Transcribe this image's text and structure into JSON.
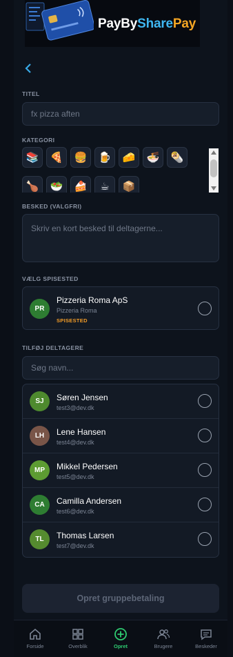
{
  "brand": {
    "part1": "PayBy",
    "part2": "Share",
    "part3": "Pay"
  },
  "form": {
    "title_label": "TITEL",
    "title_placeholder": "fx pizza aften",
    "category_label": "KATEGORI",
    "categories": [
      "📚",
      "🍕",
      "🍔",
      "🍺",
      "🧀",
      "🍜",
      "🌯",
      "🍗",
      "🥗",
      "🍰",
      "☕",
      "📦"
    ],
    "message_label": "BESKED (VALGFRI)",
    "message_placeholder": "Skriv en kort besked til deltagerne...",
    "venue_label": "VÆLG SPISESTED",
    "venue": {
      "initials": "PR",
      "name": "Pizzeria Roma ApS",
      "sub": "Pizzeria Roma",
      "tag": "SPISESTED",
      "color": "#2e7d32"
    },
    "participants_label": "TILFØJ DELTAGERE",
    "search_placeholder": "Søg navn...",
    "participants": [
      {
        "initials": "SJ",
        "name": "Søren Jensen",
        "email": "test3@dev.dk",
        "color": "#4e8a2e"
      },
      {
        "initials": "LH",
        "name": "Lene Hansen",
        "email": "test4@dev.dk",
        "color": "#795548"
      },
      {
        "initials": "MP",
        "name": "Mikkel Pedersen",
        "email": "test5@dev.dk",
        "color": "#5d9c32"
      },
      {
        "initials": "CA",
        "name": "Camilla Andersen",
        "email": "test6@dev.dk",
        "color": "#2e7d32"
      },
      {
        "initials": "TL",
        "name": "Thomas Larsen",
        "email": "test7@dev.dk",
        "color": "#558b2f"
      }
    ],
    "submit_label": "Opret gruppebetaling"
  },
  "tabs": [
    {
      "label": "Forside",
      "icon": "home-icon"
    },
    {
      "label": "Overblik",
      "icon": "grid-icon"
    },
    {
      "label": "Opret",
      "icon": "plus-circle-icon",
      "active": true
    },
    {
      "label": "Brugere",
      "icon": "users-icon"
    },
    {
      "label": "Beskeder",
      "icon": "chat-icon"
    }
  ],
  "colors": {
    "accent": "#2ecc71",
    "link": "#38a9e6",
    "tag": "#f39c27"
  }
}
